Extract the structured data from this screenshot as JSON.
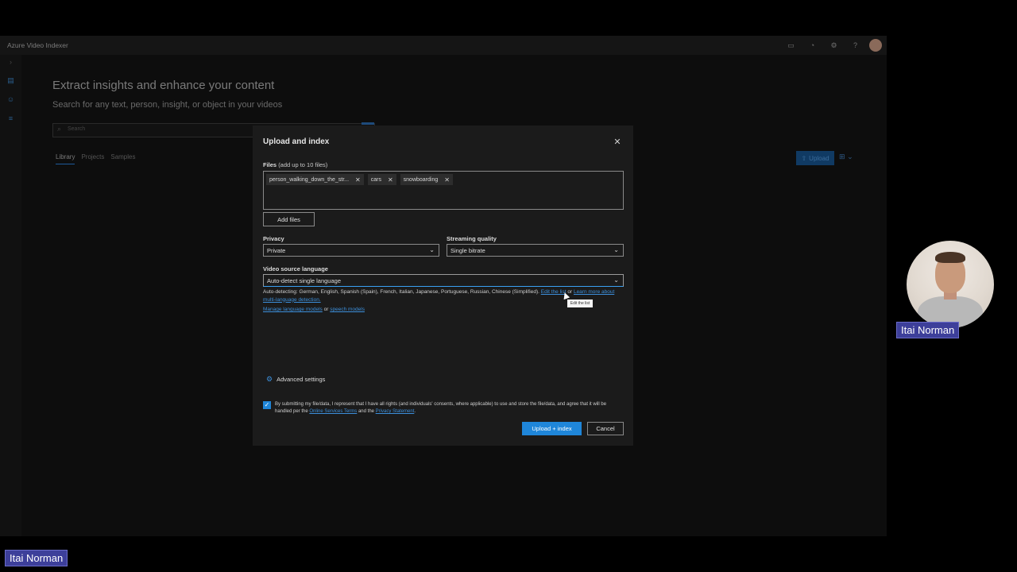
{
  "app": {
    "title": "Azure Video Indexer",
    "page_heading": "Extract insights and enhance your content",
    "page_subheading": "Search for any text, person, insight, or object in your videos",
    "search_placeholder": "Search",
    "tabs": [
      {
        "label": "Library"
      },
      {
        "label": "Projects"
      },
      {
        "label": "Samples"
      }
    ],
    "upload_label": "Upload"
  },
  "dialog": {
    "title": "Upload and index",
    "files_label": "Files",
    "files_note": "(add up to 10 files)",
    "files": [
      {
        "name": "person_walking_down_the_str..."
      },
      {
        "name": "cars"
      },
      {
        "name": "snowboarding"
      }
    ],
    "add_files": "Add files",
    "privacy_label": "Privacy",
    "privacy_value": "Private",
    "streaming_label": "Streaming quality",
    "streaming_value": "Single bitrate",
    "language_label": "Video source language",
    "language_value": "Auto-detect single language",
    "autodetect_text": "Auto-detecting: German, English, Spanish (Spain), French, Italian, Japanese, Portuguese, Russian, Chinese (Simplified).",
    "edit_list_link": "Edit the list",
    "or_text": "or",
    "learn_more_link": "Learn more about multi-language detection.",
    "manage_models_link": "Manage language models",
    "speech_models_link": "speech models",
    "tooltip": "Edit the list",
    "advanced_settings": "Advanced settings",
    "consent_pre": "By submitting my file/data, I represent that I have all rights (and individuals' consents, where applicable) to use and store the file/data, and agree that it will be handled per the",
    "consent_link1": "Online Services Terms",
    "consent_and": "and the",
    "consent_link2": "Privacy Statement",
    "consent_end": ".",
    "upload_button": "Upload + index",
    "cancel_button": "Cancel"
  },
  "presenter": {
    "name": "Itai Norman"
  },
  "colors": {
    "accent": "#1f86d9",
    "link": "#3c8fdb",
    "name_tag": "#3d3f9a"
  }
}
